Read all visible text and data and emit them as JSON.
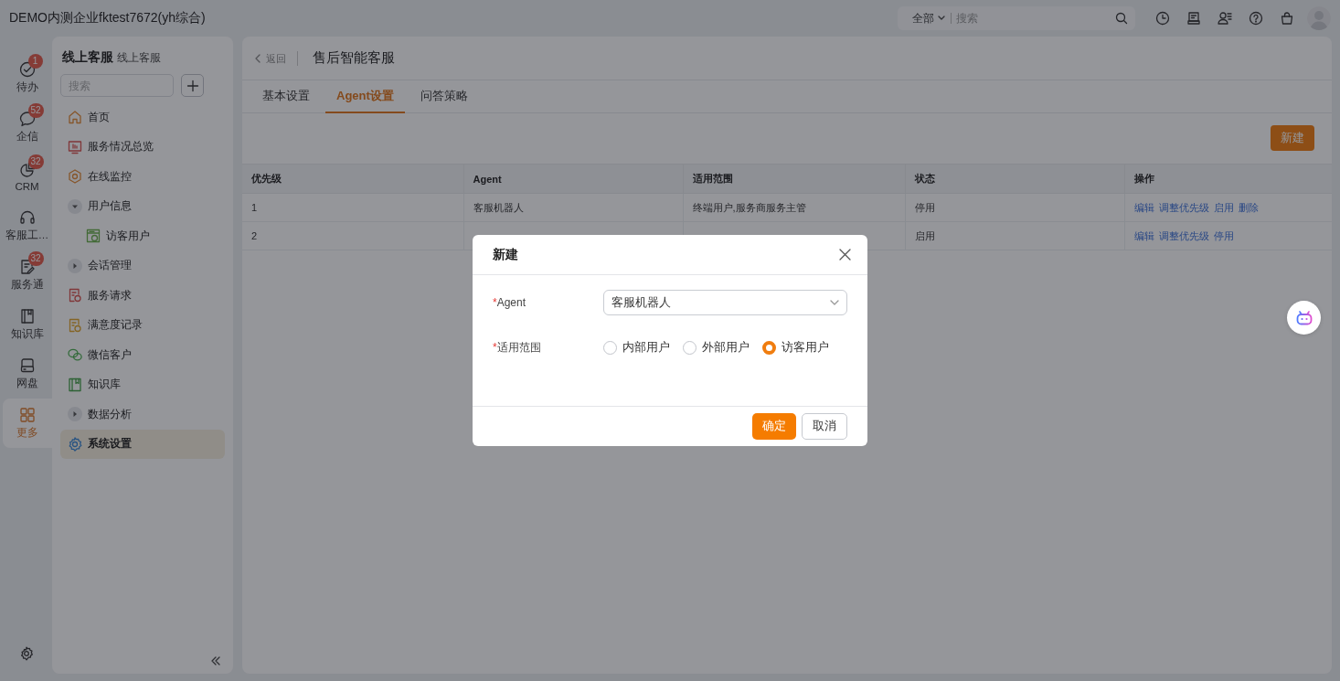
{
  "topbar": {
    "company": "DEMO内测企业fktest7672(yh综合)",
    "search_scope": "全部",
    "search_placeholder": "搜索"
  },
  "rail": {
    "items": [
      {
        "label": "待办",
        "badge": "1",
        "selected": false
      },
      {
        "label": "企信",
        "badge": "52",
        "selected": false
      },
      {
        "label": "CRM",
        "badge": "32",
        "selected": false
      },
      {
        "label": "客服工…",
        "selected": false
      },
      {
        "label": "服务通",
        "badge": "32",
        "selected": false
      },
      {
        "label": "知识库",
        "selected": false
      },
      {
        "label": "网盘",
        "selected": false
      },
      {
        "label": "更多",
        "selected": true
      }
    ]
  },
  "sidebar": {
    "title": "线上客服",
    "subtitle": "线上客服",
    "search_placeholder": "搜索",
    "items": [
      {
        "label": "首页",
        "kind": "item",
        "selected": false
      },
      {
        "label": "服务情况总览",
        "kind": "item",
        "selected": false
      },
      {
        "label": "在线监控",
        "kind": "item",
        "selected": false
      },
      {
        "label": "用户信息",
        "kind": "group",
        "expanded": true,
        "children": [
          {
            "label": "访客用户",
            "kind": "item",
            "selected": false
          }
        ]
      },
      {
        "label": "会话管理",
        "kind": "group",
        "expanded": false
      },
      {
        "label": "服务请求",
        "kind": "item",
        "selected": false
      },
      {
        "label": "满意度记录",
        "kind": "item",
        "selected": false
      },
      {
        "label": "微信客户",
        "kind": "item",
        "selected": false
      },
      {
        "label": "知识库",
        "kind": "item",
        "selected": false
      },
      {
        "label": "数据分析",
        "kind": "group",
        "expanded": false
      },
      {
        "label": "系统设置",
        "kind": "item",
        "selected": true
      }
    ]
  },
  "main": {
    "back": "返回",
    "title": "售后智能客服",
    "tabs": [
      {
        "label": "基本设置",
        "selected": false
      },
      {
        "label": "Agent设置",
        "selected": true
      },
      {
        "label": "问答策略",
        "selected": false
      }
    ],
    "new_button": "新建",
    "table": {
      "columns": [
        "优先级",
        "Agent",
        "适用范围",
        "状态",
        "操作"
      ],
      "rows": [
        {
          "priority": "1",
          "agent": "客服机器人",
          "scope": "终端用户,服务商服务主管",
          "status": "停用",
          "actions": [
            "编辑",
            "调整优先级",
            "启用",
            "删除"
          ]
        },
        {
          "priority": "2",
          "status": "启用",
          "actions": [
            "编辑",
            "调整优先级",
            "停用"
          ]
        }
      ]
    }
  },
  "modal": {
    "title": "新建",
    "fields": [
      {
        "kind": "select",
        "label": "Agent",
        "required_mark": "*",
        "value": "客服机器人"
      },
      {
        "kind": "radio",
        "label": "适用范围",
        "required_mark": "*",
        "options": [
          {
            "label": "内部用户",
            "selected": false
          },
          {
            "label": "外部用户",
            "selected": false
          },
          {
            "label": "访客用户",
            "selected": true
          }
        ]
      }
    ],
    "buttons": [
      {
        "label": "确定",
        "kind": "primary"
      },
      {
        "label": "取消",
        "kind": "default"
      }
    ]
  }
}
